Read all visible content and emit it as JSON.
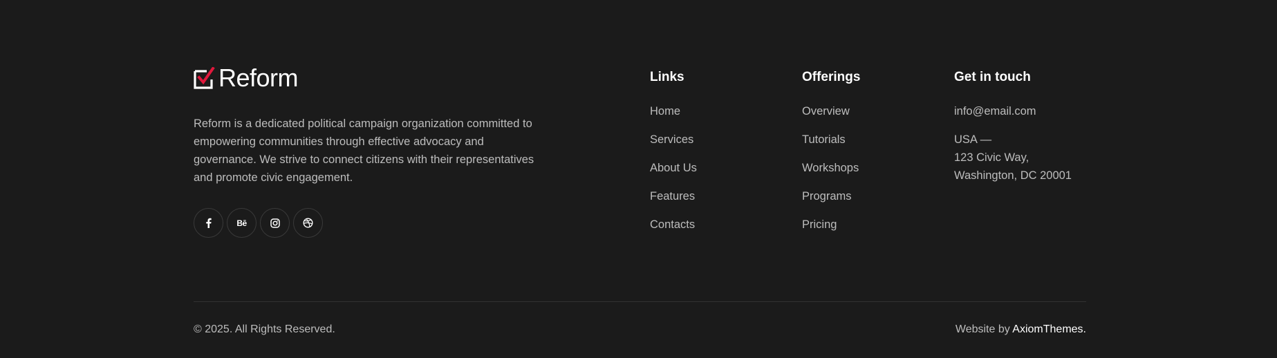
{
  "brand": {
    "name": "Reform",
    "description": "Reform is a dedicated political campaign organization committed to empowering communities through effective advocacy and governance. We strive to connect citizens with their representatives and promote civic engagement.",
    "accent_color": "#e0183c"
  },
  "socials": [
    {
      "icon": "facebook-icon"
    },
    {
      "icon": "behance-icon",
      "glyph": "Bē"
    },
    {
      "icon": "instagram-icon"
    },
    {
      "icon": "dribbble-icon"
    }
  ],
  "links": {
    "title": "Links",
    "items": [
      "Home",
      "Services",
      "About Us",
      "Features",
      "Contacts"
    ]
  },
  "offerings": {
    "title": "Offerings",
    "items": [
      "Overview",
      "Tutorials",
      "Workshops",
      "Programs",
      "Pricing"
    ]
  },
  "contact": {
    "title": "Get in touch",
    "email": "info@email.com",
    "address": [
      "USA —",
      "123 Civic Way,",
      "Washington, DC 20001"
    ]
  },
  "bottom": {
    "copyright": "© 2025. All Rights Reserved.",
    "credit_prefix": "Website by ",
    "credit_link": "AxiomThemes."
  }
}
